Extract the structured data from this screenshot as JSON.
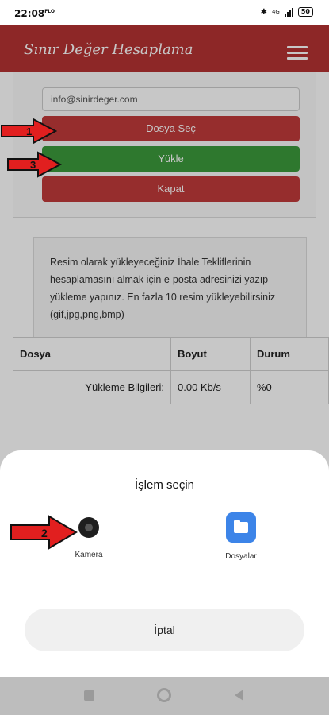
{
  "status_bar": {
    "time": "22:08",
    "suffix": "FLO",
    "network": "4G",
    "battery": "50"
  },
  "header": {
    "title": "Sınır Değer Hesaplama",
    "menu_icon": "hamburger-menu-icon"
  },
  "form": {
    "email_value": "info@sinirdeger.com",
    "choose_file_label": "Dosya Seç",
    "upload_label": "Yükle",
    "close_label": "Kapat"
  },
  "info_text": "Resim olarak yükleyeceğiniz İhale Tekliflerinin hesaplamasını almak için e-posta adresinizi yazıp yükleme yapınız. En fazla 10 resim yükleyebilirsiniz (gif,jpg,png,bmp)",
  "table": {
    "headers": [
      "Dosya",
      "Boyut",
      "Durum"
    ],
    "row": [
      "Yükleme Bilgileri:",
      "0.00 Kb/s",
      "%0"
    ]
  },
  "sheet": {
    "title": "İşlem seçin",
    "options": [
      {
        "label": "Kamera",
        "icon": "camera-icon"
      },
      {
        "label": "Dosyalar",
        "icon": "files-icon"
      }
    ],
    "cancel_label": "İptal"
  },
  "annotations": [
    "1",
    "2",
    "3"
  ],
  "colors": {
    "header": "#b53232",
    "danger_button": "#c13a3a",
    "upload_button": "#3b9a3b",
    "arrow": "#e11f1f"
  }
}
